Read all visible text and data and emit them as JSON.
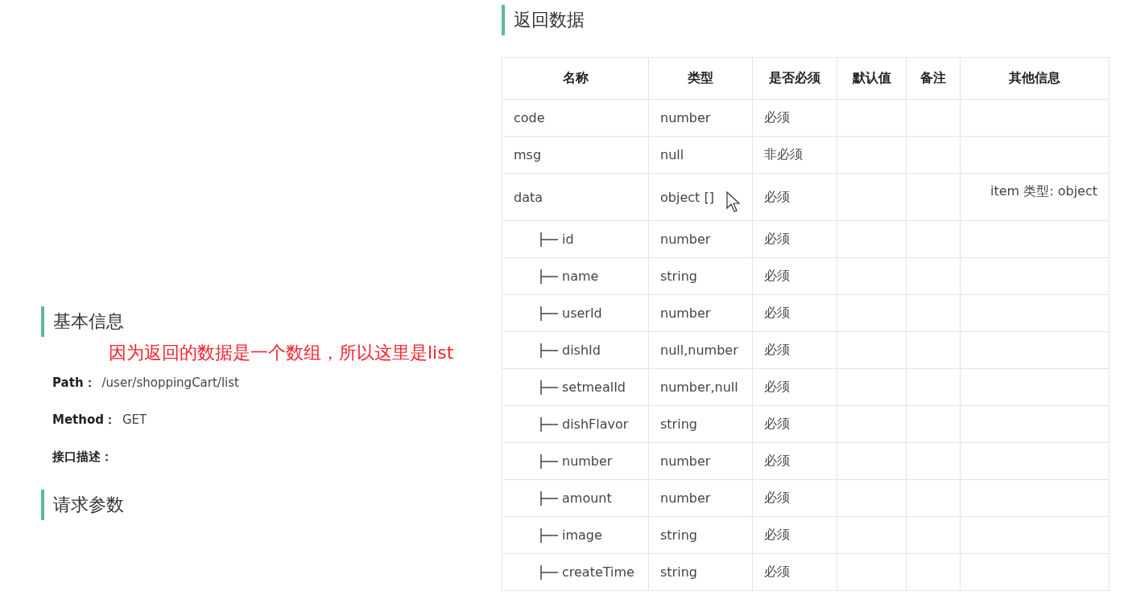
{
  "basic_info": {
    "title": "基本信息",
    "annotation": "因为返回的数据是一个数组，所以这里是list",
    "fields": [
      {
        "label": "Path：",
        "value": "/user/shoppingCart/list"
      },
      {
        "label": "Method：",
        "value": "GET"
      },
      {
        "label": "接口描述："
      }
    ]
  },
  "request_params": {
    "title": "请求参数"
  },
  "response": {
    "title": "返回数据",
    "columns": [
      "名称",
      "类型",
      "是否必须",
      "默认值",
      "备注",
      "其他信息"
    ],
    "rows": [
      {
        "name": "code",
        "type": "number",
        "required": "必须"
      },
      {
        "name": "msg",
        "type": "null",
        "required": "非必须"
      },
      {
        "name": "data",
        "type": "object []",
        "required": "必须",
        "other": "item 类型: object",
        "cursor": true,
        "children": [
          {
            "name": "id",
            "type": "number",
            "required": "必须"
          },
          {
            "name": "name",
            "type": "string",
            "required": "必须"
          },
          {
            "name": "userId",
            "type": "number",
            "required": "必须"
          },
          {
            "name": "dishId",
            "type": "null,number",
            "required": "必须"
          },
          {
            "name": "setmealId",
            "type": "number,null",
            "required": "必须"
          },
          {
            "name": "dishFlavor",
            "type": "string",
            "required": "必须"
          },
          {
            "name": "number",
            "type": "number",
            "required": "必须"
          },
          {
            "name": "amount",
            "type": "number",
            "required": "必须"
          },
          {
            "name": "image",
            "type": "string",
            "required": "必须"
          },
          {
            "name": "createTime",
            "type": "string",
            "required": "必须"
          }
        ]
      }
    ]
  }
}
